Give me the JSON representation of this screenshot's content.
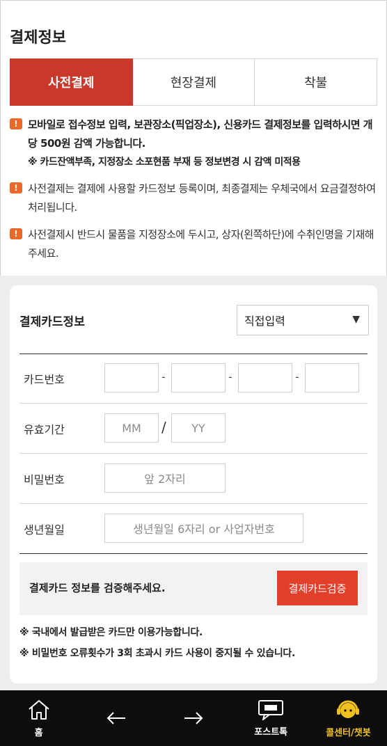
{
  "page": {
    "title": "결제정보"
  },
  "tabs": [
    {
      "label": "사전결제",
      "active": true
    },
    {
      "label": "현장결제",
      "active": false
    },
    {
      "label": "착불",
      "active": false
    }
  ],
  "notes": [
    {
      "text": "모바일로 접수정보 입력, 보관장소(픽업장소), 신용카드 결제정보를 입력하시면 개당 500원 감액 가능합니다.",
      "sub": "※ 카드잔액부족, 지정장소 소포현품 부재 등 정보변경 시 감액 미적용",
      "icon": "!"
    },
    {
      "text": "사전결제는 결제에 사용할 카드정보 등록이며, 최종결제는 우체국에서 요금결정하여 처리됩니다.",
      "icon": "!"
    },
    {
      "text": "사전결제시 반드시 물품을 지정장소에 두시고, 상자(왼쪽하단)에 수취인명을 기재해 주세요.",
      "icon": "!"
    }
  ],
  "card": {
    "title": "결제카드정보",
    "select_value": "직접입력",
    "select_arrow": "▼",
    "rows": {
      "card_number": {
        "label": "카드번호",
        "dash": "-"
      },
      "expiry": {
        "label": "유효기간",
        "mm": "MM",
        "yy": "YY",
        "slash": "/"
      },
      "password": {
        "label": "비밀번호",
        "placeholder": "앞 2자리"
      },
      "birth": {
        "label": "생년월일",
        "placeholder": "생년월일 6자리 or 사업자번호"
      }
    },
    "verify_text": "결제카드 정보를 검증해주세요.",
    "verify_button": "결제카드검증",
    "foot_notes": [
      "※ 국내에서 발급받은 카드만 이용가능합니다.",
      "※ 비밀번호 오류횟수가 3회 초과시 카드 사용이 중지될 수 있습니다."
    ]
  },
  "nav": {
    "home": {
      "label": "홈",
      "icon": "home-icon"
    },
    "back": {
      "label": "",
      "icon": "arrow-left-icon"
    },
    "forward": {
      "label": "",
      "icon": "arrow-right-icon"
    },
    "posttalk": {
      "label": "포스트톡",
      "icon": "chat-icon"
    },
    "callcenter": {
      "label": "콜센터/챗봇",
      "icon": "headset-icon"
    }
  },
  "colors": {
    "accent": "#c8392b",
    "button": "#e2402a",
    "note_icon": "#e8692a",
    "nav_bg": "#0d0d0d",
    "nav_gold": "#f0c020"
  }
}
